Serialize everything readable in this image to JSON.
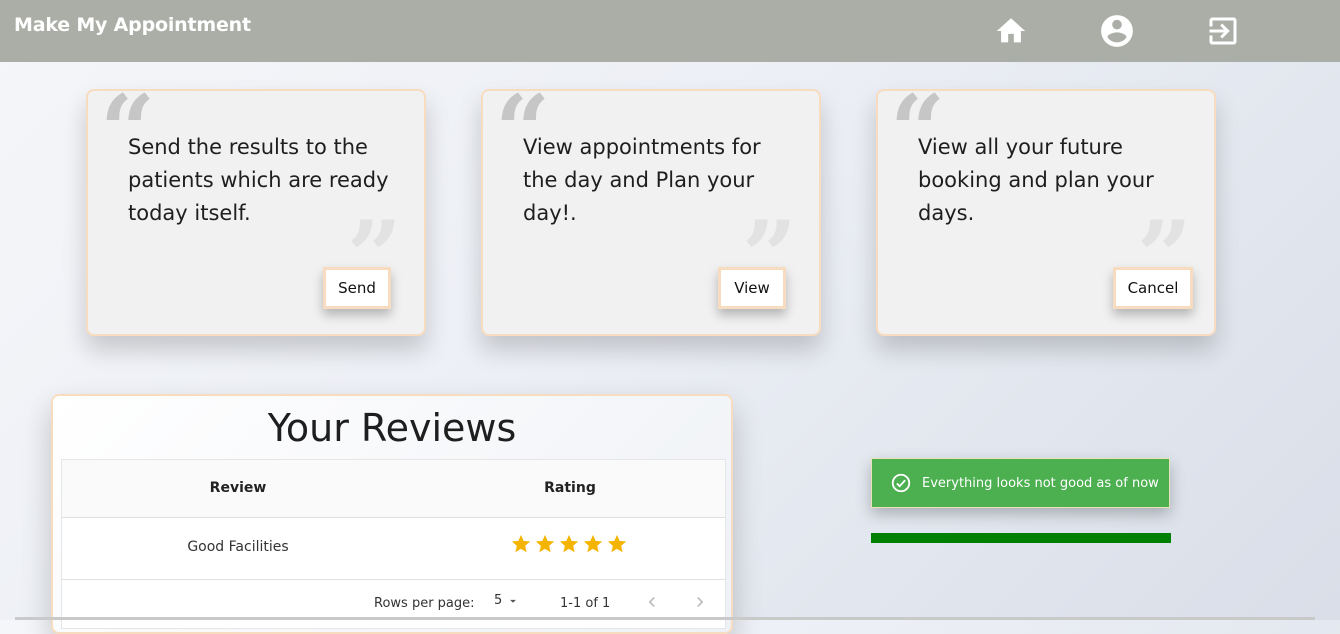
{
  "header": {
    "brand": "Make My Appointment",
    "nav": [
      {
        "icon": "home-icon"
      },
      {
        "icon": "account-circle-icon"
      },
      {
        "icon": "exit-icon"
      }
    ],
    "bg_color": "#abaea6"
  },
  "cards": [
    {
      "text": "Send the results to the patients which are ready today itself.",
      "button": "Send"
    },
    {
      "text": "View appointments for the day and Plan your day!.",
      "button": "View"
    },
    {
      "text": "View all your future booking and plan your days.",
      "button": "Cancel"
    }
  ],
  "reviews": {
    "title": "Your Reviews",
    "columns": [
      "Review",
      "Rating"
    ],
    "rows": [
      {
        "review": "Good Facilities",
        "rating": 5,
        "max_rating": 5
      }
    ],
    "pagination": {
      "rows_per_page_label": "Rows per page:",
      "rows_per_page": "5",
      "range": "1-1 of 1"
    }
  },
  "toast": {
    "message": "Everything looks not good as of now",
    "color": "#4caf50",
    "progress": 1.0,
    "progress_color": "#008000"
  },
  "colors": {
    "star": "#f5b400",
    "card_border": "#f8dcc0"
  }
}
